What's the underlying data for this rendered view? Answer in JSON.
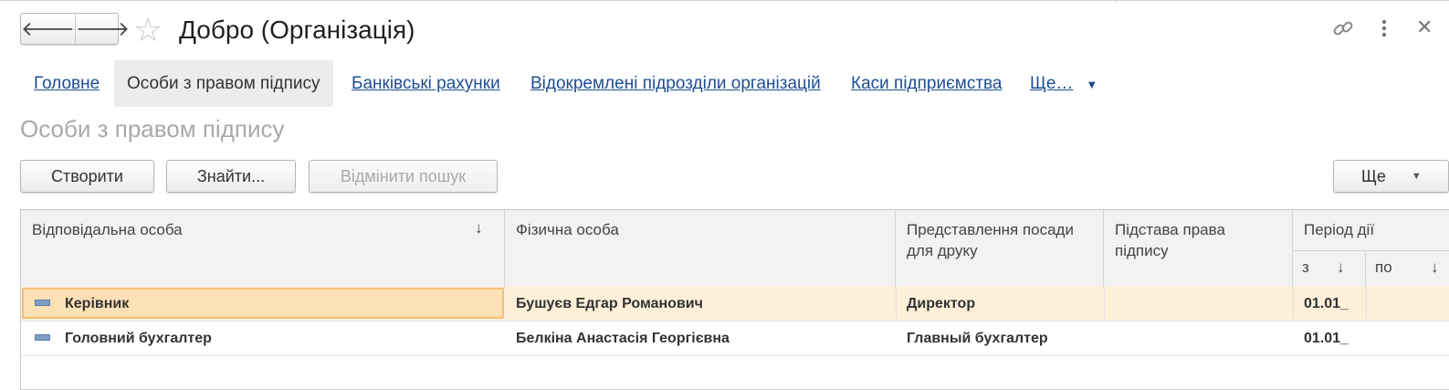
{
  "window": {
    "title": "Добро (Організація)",
    "back_icon": "arrow-left-icon",
    "forward_icon": "arrow-right-icon",
    "favorite_icon": "star-icon",
    "link_icon": "link-icon",
    "menu_icon": "kebab-menu-icon",
    "close_icon": "close-icon"
  },
  "tabs": [
    {
      "label": "Головне",
      "active": false
    },
    {
      "label": "Особи з правом підпису",
      "active": true
    },
    {
      "label": "Банківські рахунки",
      "active": false
    },
    {
      "label": "Відокремлені підрозділи організацій",
      "active": false
    },
    {
      "label": "Каси підприємства",
      "active": false
    },
    {
      "label": "Ще…",
      "active": false
    }
  ],
  "section_title": "Особи з правом підпису",
  "toolbar": {
    "create": "Створити",
    "find": "Знайти...",
    "cancel_search": "Відмінити пошук",
    "more": "Ще"
  },
  "table": {
    "columns": {
      "responsible": "Відповідальна особа",
      "person": "Фізична особа",
      "position": "Представлення посади для друку",
      "basis": "Підстава права підпису",
      "period": "Період дії",
      "period_from": "з",
      "period_to": "по"
    },
    "rows": [
      {
        "responsible": "Керівник",
        "person": "Бушуєв Едгар Романович",
        "position": "Директор",
        "basis": "",
        "from": "01.01_",
        "to": "",
        "selected": true
      },
      {
        "responsible": "Головний бухгалтер",
        "person": "Белкіна Анастасія Георгієвна",
        "position": "Главный бухгалтер",
        "basis": "",
        "from": "01.01_",
        "to": "",
        "selected": false
      }
    ]
  },
  "colors": {
    "link": "#1f4d93",
    "selected_row": "#fdefd8",
    "focus_border": "#f2c27a",
    "header_bg": "#f2f2f2"
  }
}
